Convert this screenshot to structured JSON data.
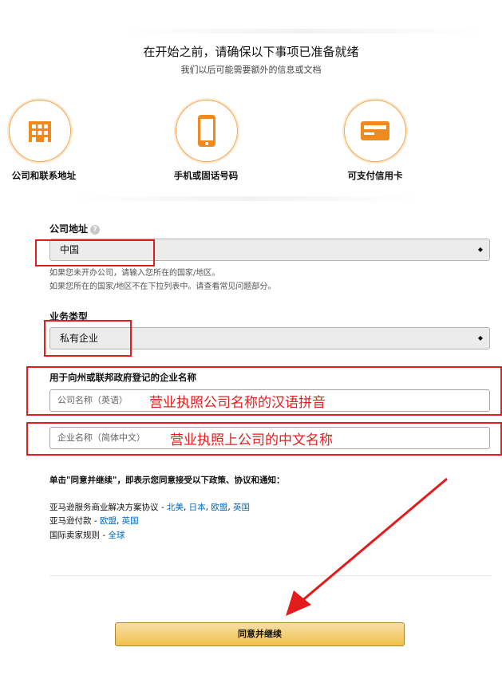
{
  "header": {
    "title": "在开始之前，请确保以下事项已准备就绪",
    "subtitle": "我们以后可能需要额外的信息或文档"
  },
  "requirements": [
    {
      "label": "公司和联系地址",
      "icon": "building-icon"
    },
    {
      "label": "手机或固话号码",
      "icon": "mobile-phone-icon"
    },
    {
      "label": "可支付信用卡",
      "icon": "credit-card-icon"
    }
  ],
  "colors": {
    "accent": "#f0a64c",
    "annotation": "#e31b1b",
    "link": "#0066c0",
    "button": "#f0c14b"
  },
  "form": {
    "company_address_label": "公司地址",
    "help_icon_text": "?",
    "country_value": "中国",
    "country_note_1": "如果您未开办公司，请输入您所在的国家/地区。",
    "country_note_2": "如果您所在的国家/地区不在下拉列表中。请查看常见问题部分。",
    "business_type_label": "业务类型",
    "business_type_value": "私有企业",
    "company_name_label": "用于向州或联邦政府登记的企业名称",
    "name_en_placeholder": "公司名称（英语）",
    "name_cn_placeholder": "企业名称（简体中文）",
    "select_arrows": "◆"
  },
  "annotations": {
    "pinyin_note": "营业执照公司名称的汉语拼音",
    "chinese_note": "营业执照上公司的中文名称"
  },
  "terms": {
    "intro": "单击\"同意并继续\"，即表示您同意接受以下政策、协议和通知：",
    "items": [
      {
        "text": "亚马逊服务商业解决方案协议 - ",
        "links": [
          "北美",
          "日本",
          "欧盟",
          "英国"
        ]
      },
      {
        "text": "亚马逊付款 - ",
        "links": [
          "欧盟",
          "英国"
        ]
      },
      {
        "text": "国际卖家规则 - ",
        "links": [
          "全球"
        ]
      }
    ]
  },
  "submit_label": "同意并继续"
}
